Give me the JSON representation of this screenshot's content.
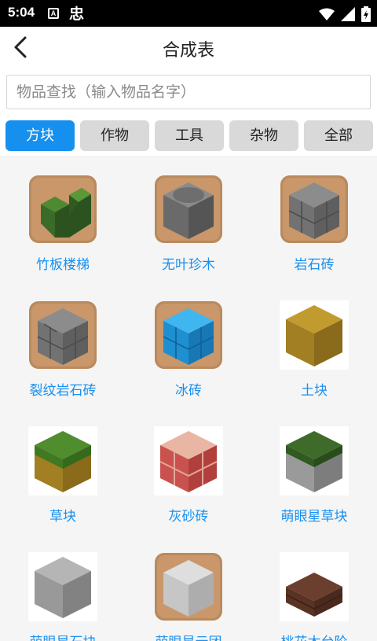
{
  "status_bar": {
    "time": "5:04",
    "a_badge": "A",
    "bug_glyph": "忠"
  },
  "header": {
    "title": "合成表"
  },
  "search": {
    "placeholder": "物品查找（输入物品名字）"
  },
  "tabs": [
    {
      "label": "方块",
      "active": true
    },
    {
      "label": "作物",
      "active": false
    },
    {
      "label": "工具",
      "active": false
    },
    {
      "label": "杂物",
      "active": false
    },
    {
      "label": "全部",
      "active": false
    }
  ],
  "items": [
    {
      "label": "竹板楼梯",
      "icon": "bamboo-stairs-icon"
    },
    {
      "label": "无叶珍木",
      "icon": "leafless-log-icon"
    },
    {
      "label": "岩石砖",
      "icon": "stone-brick-icon"
    },
    {
      "label": "裂纹岩石砖",
      "icon": "cracked-stone-brick-icon"
    },
    {
      "label": "冰砖",
      "icon": "ice-brick-icon"
    },
    {
      "label": "土块",
      "icon": "dirt-block-icon"
    },
    {
      "label": "草块",
      "icon": "grass-block-icon"
    },
    {
      "label": "灰砂砖",
      "icon": "red-brick-icon"
    },
    {
      "label": "萌眼星草块",
      "icon": "gray-grass-block-icon"
    },
    {
      "label": "萌眼星石块",
      "icon": "gray-stone-block-icon"
    },
    {
      "label": "萌眼星云团",
      "icon": "cloud-block-icon"
    },
    {
      "label": "桃花木台阶",
      "icon": "wood-slab-icon"
    }
  ],
  "colors": {
    "accent": "#1590ef",
    "tab_inactive": "#d9d9d9",
    "label": "#1890f0",
    "grid_bg": "#f5f5f5"
  }
}
